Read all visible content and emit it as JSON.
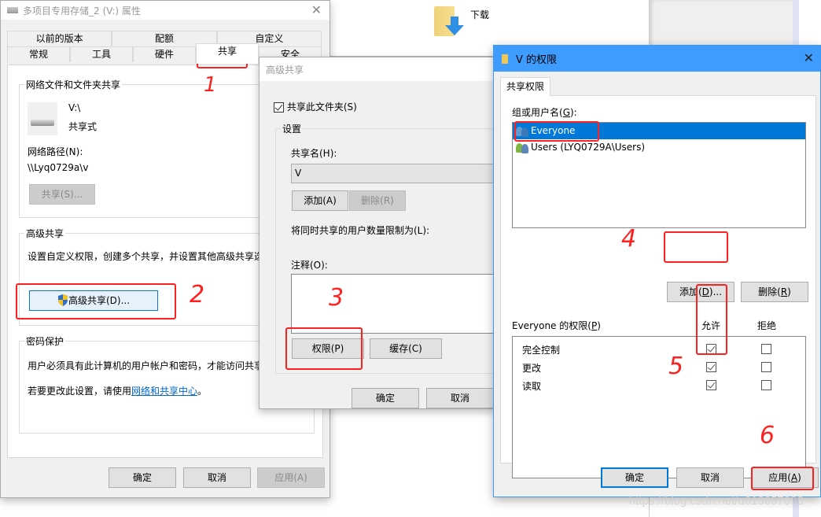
{
  "background": {
    "explorer_item": {
      "icon": "downloads-folder-icon",
      "label": "下载"
    }
  },
  "properties_window": {
    "title": "多项目专用存储_2 (V:) 属性",
    "tabs_row1": [
      "以前的版本",
      "配额",
      "自定义"
    ],
    "tabs_row2": [
      "常规",
      "工具",
      "硬件",
      "共享",
      "安全"
    ],
    "active_tab": "共享",
    "network_sharing": {
      "group_title": "网络文件和文件夹共享",
      "drive_name": "V:\\",
      "drive_status": "共享式",
      "path_label": "网络路径(N):",
      "path_value": "\\\\Lyq0729a\\v",
      "share_button": "共享(S)..."
    },
    "advanced_sharing": {
      "group_title": "高级共享",
      "description": "设置自定义权限，创建多个共享，并设置其他高级共享选",
      "button": "高级共享(D)..."
    },
    "password_protection": {
      "group_title": "密码保护",
      "description": "用户必须具有此计算机的用户帐户和密码，才能访问共享",
      "change_prefix": "若要更改此设置，请使用",
      "change_link": "网络和共享中心",
      "change_suffix": "。"
    },
    "buttons": {
      "ok": "确定",
      "cancel": "取消",
      "apply": "应用(A)"
    }
  },
  "advanced_sharing_window": {
    "title": "高级共享",
    "share_checkbox_label": "共享此文件夹(S)",
    "share_checked": true,
    "settings_group": "设置",
    "share_name_label": "共享名(H):",
    "share_name_value": "V",
    "add_button": "添加(A)",
    "remove_button": "删除(R)",
    "limit_label": "将同时共享的用户数量限制为(L):",
    "comment_label": "注释(O):",
    "comment_value": "",
    "permissions_button": "权限(P)",
    "caching_button": "缓存(C)",
    "buttons": {
      "ok": "确定",
      "cancel": "取消"
    }
  },
  "permissions_window": {
    "title": "V 的权限",
    "tab": "共享权限",
    "group_label": "组或用户名(G):",
    "users": [
      {
        "name": "Everyone",
        "selected": true
      },
      {
        "name": "Users (LYQ0729A\\Users)",
        "selected": false
      }
    ],
    "add_button": "添加(D)...",
    "remove_button": "删除(R)",
    "perm_label": "Everyone 的权限(P)",
    "col_allow": "允许",
    "col_deny": "拒绝",
    "permissions": [
      {
        "name": "完全控制",
        "allow": true,
        "deny": false
      },
      {
        "name": "更改",
        "allow": true,
        "deny": false
      },
      {
        "name": "读取",
        "allow": true,
        "deny": false
      }
    ],
    "buttons": {
      "ok": "确定",
      "cancel": "取消",
      "apply": "应用(A)"
    }
  },
  "annotations": [
    "1",
    "2",
    "3",
    "4",
    "5",
    "6"
  ],
  "colors": {
    "annotation_red": "#ff2020",
    "title_blue": "#3f9cff",
    "selection_blue": "#0078d7",
    "link_blue": "#0066cc"
  },
  "watermark": "https://blog.csdn.net/u013657098"
}
